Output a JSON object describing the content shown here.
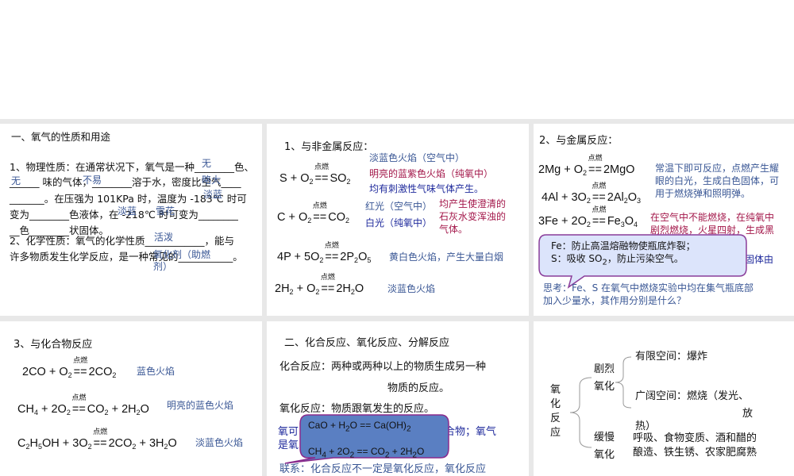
{
  "panel1": {
    "title": "一、氧气的性质和用途",
    "lines": [
      "1、物理性质：在通常状况下，氧气是一种________色、",
      "______ 味的气体，________溶于水，密度比空气____",
      "_______。在压强为 101KPa 时，温度为 -183℃ 时可",
      "变为________色液体，在 -218℃ 时可变为________",
      "__色________状固体。",
      "2、化学性质：氧气的化学性质____________，能与",
      "许多物质发生化学反应，是一种常见的___________。"
    ],
    "answers": [
      "无",
      "无",
      "不易",
      "略大",
      "淡蓝",
      "淡蓝",
      "雪花",
      "活泼",
      "氧化剂（助燃",
      "剂）"
    ]
  },
  "panel2": {
    "title": "1、与非金属反应：",
    "cond": "点燃",
    "eqs": [
      {
        "lhs": "S + O2",
        "rhs": "SO2"
      },
      {
        "lhs": "C + O2",
        "rhs": "CO2"
      },
      {
        "lhs": "4P + 5O2",
        "rhs": "2P2O5"
      },
      {
        "lhs": "2H2 + O2",
        "rhs": "2H2O"
      }
    ],
    "notes": [
      "淡蓝色火焰（空气中）",
      "明亮的蓝紫色火焰（纯氧中）",
      "均有刺激性气味气体产生。",
      "红光（空气中）",
      "白光（纯氧中）",
      "均产生使澄清的",
      "石灰水变浑浊的",
      "气体。",
      "黄白色火焰，产生大量白烟",
      "淡蓝色火焰"
    ]
  },
  "panel3": {
    "title": "2、与金属反应：",
    "cond": "点燃",
    "eqs": [
      {
        "lhs": "2Mg + O2",
        "rhs": "2MgO"
      },
      {
        "lhs": "4Al + 3O2",
        "rhs": "2Al2O3"
      },
      {
        "lhs": "3Fe + 2O2",
        "rhs": "Fe3O4"
      }
    ],
    "notes": [
      "常温下即可反应，点燃产生耀",
      "眼的白光，生成白色固体，可",
      "用于燃烧弹和照明弹。",
      "在空气中不能燃烧，在纯氧中",
      "剧烈燃烧，火星四射，生成黑",
      "色固体由"
    ],
    "callout": [
      "Fe：防止高温熔融物使瓶底炸裂；",
      "S：吸收 SO2，防止污染空气。"
    ],
    "think": [
      "思考：Fe、S 在氧气中燃烧实验中均在集气瓶底部",
      "加入少量水，其作用分别是什么？"
    ]
  },
  "panel4": {
    "title": "3、与化合物反应",
    "cond": "点燃",
    "eqs": [
      {
        "lhs": "2CO + O2",
        "rhs": "2CO2"
      },
      {
        "lhs": "CH4 + 2O2",
        "rhs": "CO2 + 2H2O"
      },
      {
        "lhs": "C2H5OH + 3O2",
        "rhs": "2CO2 + 3H2O"
      }
    ],
    "notes": [
      "蓝色火焰",
      "明亮的蓝色火焰",
      "淡蓝色火焰"
    ]
  },
  "panel5": {
    "title": "二、化合反应、氧化反应、分解反应",
    "lines": [
      "化合反应：两种或两种以上的物质生成另一种",
      "物质的反应。",
      "氧化反应：物质跟氧发生的反应。"
    ],
    "hidden": [
      "氧可",
      "合物；氧气",
      "是氧"
    ],
    "callout": [
      "CaO + H2O == Ca(OH)2",
      "CH4 + 2O2 == CO2 + 2H2O"
    ],
    "link": "联系：化合反应不一定是氧化反应，氧化反应"
  },
  "panel6": {
    "root": "氧化反应",
    "violent": "剧烈氧化",
    "slow": "缓慢氧化",
    "limited": "有限空间：爆炸",
    "open1": "广阔空间：燃烧（发光、",
    "open2": "放",
    "open3": "热）",
    "slow1": "呼吸、食物变质、酒和醋的",
    "slow2": "酿造、铁生锈、农家肥腐熟"
  }
}
